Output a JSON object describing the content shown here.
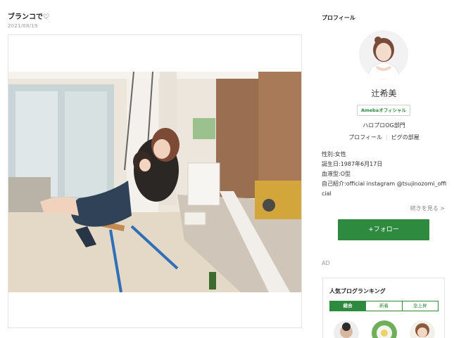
{
  "post": {
    "title": "ブランコで♡",
    "date": "2021/08/19"
  },
  "sidebar": {
    "heading": "プロフィール",
    "name": "辻希美",
    "badge": "Amebaオフィシャル",
    "group": "ハロプロOG部門",
    "links": [
      "プロフィール",
      "ピグの部屋"
    ],
    "info": {
      "gender": "性別:女性",
      "birthday": "誕生日:1987年6月17日",
      "blood": "血液型:O型",
      "intro": "自己紹介:official instagram @tsujinozomi_official"
    },
    "more": "続きを見る >",
    "follow": "+フォロー",
    "ad": "AD"
  },
  "ranking": {
    "title": "人気ブログランキング",
    "tabs": [
      "総合",
      "新着",
      "急上昇"
    ]
  },
  "colors": {
    "accent_green": "#2d8a3f",
    "frame_border": "#e4e4e4"
  }
}
